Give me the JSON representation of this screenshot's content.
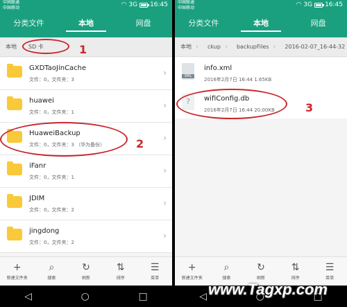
{
  "status": {
    "carrier1": "中国联通",
    "carrier2": "中国移动",
    "signal": "3G",
    "time": "16:45"
  },
  "tabs": [
    "分类文件",
    "本地",
    "网盘"
  ],
  "left": {
    "breadcrumb": [
      "本地",
      "SD 卡"
    ],
    "folders": [
      {
        "name": "GXDTaoJinCache",
        "meta": "文件：0，文件夹：3"
      },
      {
        "name": "huawei",
        "meta": "文件：0，文件夹：1"
      },
      {
        "name": "HuaweiBackup",
        "meta": "文件：0，文件夹：3  （华为备份）"
      },
      {
        "name": "iFanr",
        "meta": "文件：0，文件夹：1"
      },
      {
        "name": "JDIM",
        "meta": "文件：0，文件夹：2"
      },
      {
        "name": "jingdong",
        "meta": "文件：0，文件夹：2"
      }
    ],
    "actions": [
      {
        "icon": "+",
        "label": "新建文件夹"
      },
      {
        "icon": "⌕",
        "label": "搜索"
      },
      {
        "icon": "↻",
        "label": "刷新"
      },
      {
        "icon": "⇅",
        "label": "排序"
      },
      {
        "icon": "☰",
        "label": "菜单"
      }
    ]
  },
  "right": {
    "breadcrumb": [
      "本地",
      "ckup",
      "backupFiles",
      "2016-02-07_16-44-32"
    ],
    "files": [
      {
        "name": "info.xml",
        "meta": "2016年2月7日 16:44 1.65KB",
        "icon_label": "XML"
      },
      {
        "name": "wifiConfig.db",
        "meta": "2016年2月7日 16:44 20.00KB",
        "icon_label": "?"
      }
    ],
    "actions": [
      {
        "icon": "+",
        "label": "新建文件夹"
      },
      {
        "icon": "⌕",
        "label": "搜索"
      },
      {
        "icon": "↻",
        "label": "刷新"
      },
      {
        "icon": "⇅",
        "label": "排序"
      },
      {
        "icon": "☰",
        "label": "菜单"
      }
    ]
  },
  "annotations": [
    "1",
    "2",
    "3"
  ],
  "nav": [
    "◁",
    "○",
    "□"
  ],
  "watermark": "www.Tagxp.com",
  "colors": {
    "header": "#1aa07f",
    "folder": "#f9c93a",
    "annotation": "#c9262c"
  }
}
